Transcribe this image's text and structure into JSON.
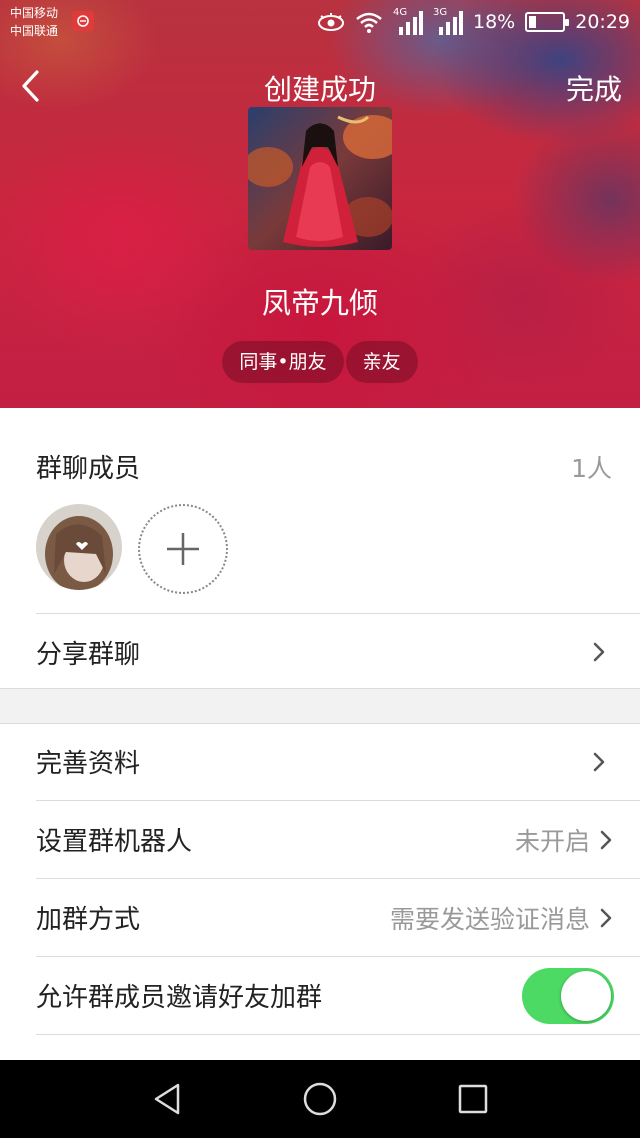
{
  "status_bar": {
    "carrier_1": "中国移动",
    "carrier_2": "中国联通",
    "net_1": "4G",
    "net_2": "3G",
    "battery_text": "18%",
    "battery_level": 0.18,
    "time": "20:29"
  },
  "nav": {
    "title": "创建成功",
    "done_label": "完成"
  },
  "group": {
    "name": "凤帝九倾",
    "tags": [
      "同事•朋友",
      "亲友"
    ]
  },
  "members": {
    "title": "群聊成员",
    "count": "1人"
  },
  "share": {
    "label": "分享群聊"
  },
  "settings": {
    "profile_label": "完善资料",
    "robot_label": "设置群机器人",
    "robot_value": "未开启",
    "join_label": "加群方式",
    "join_value": "需要发送验证消息",
    "invite_label": "允许群成员邀请好友加群",
    "invite_enabled": true
  },
  "colors": {
    "accent_toggle": "#4cd964",
    "hero_red": "#c31f44"
  }
}
